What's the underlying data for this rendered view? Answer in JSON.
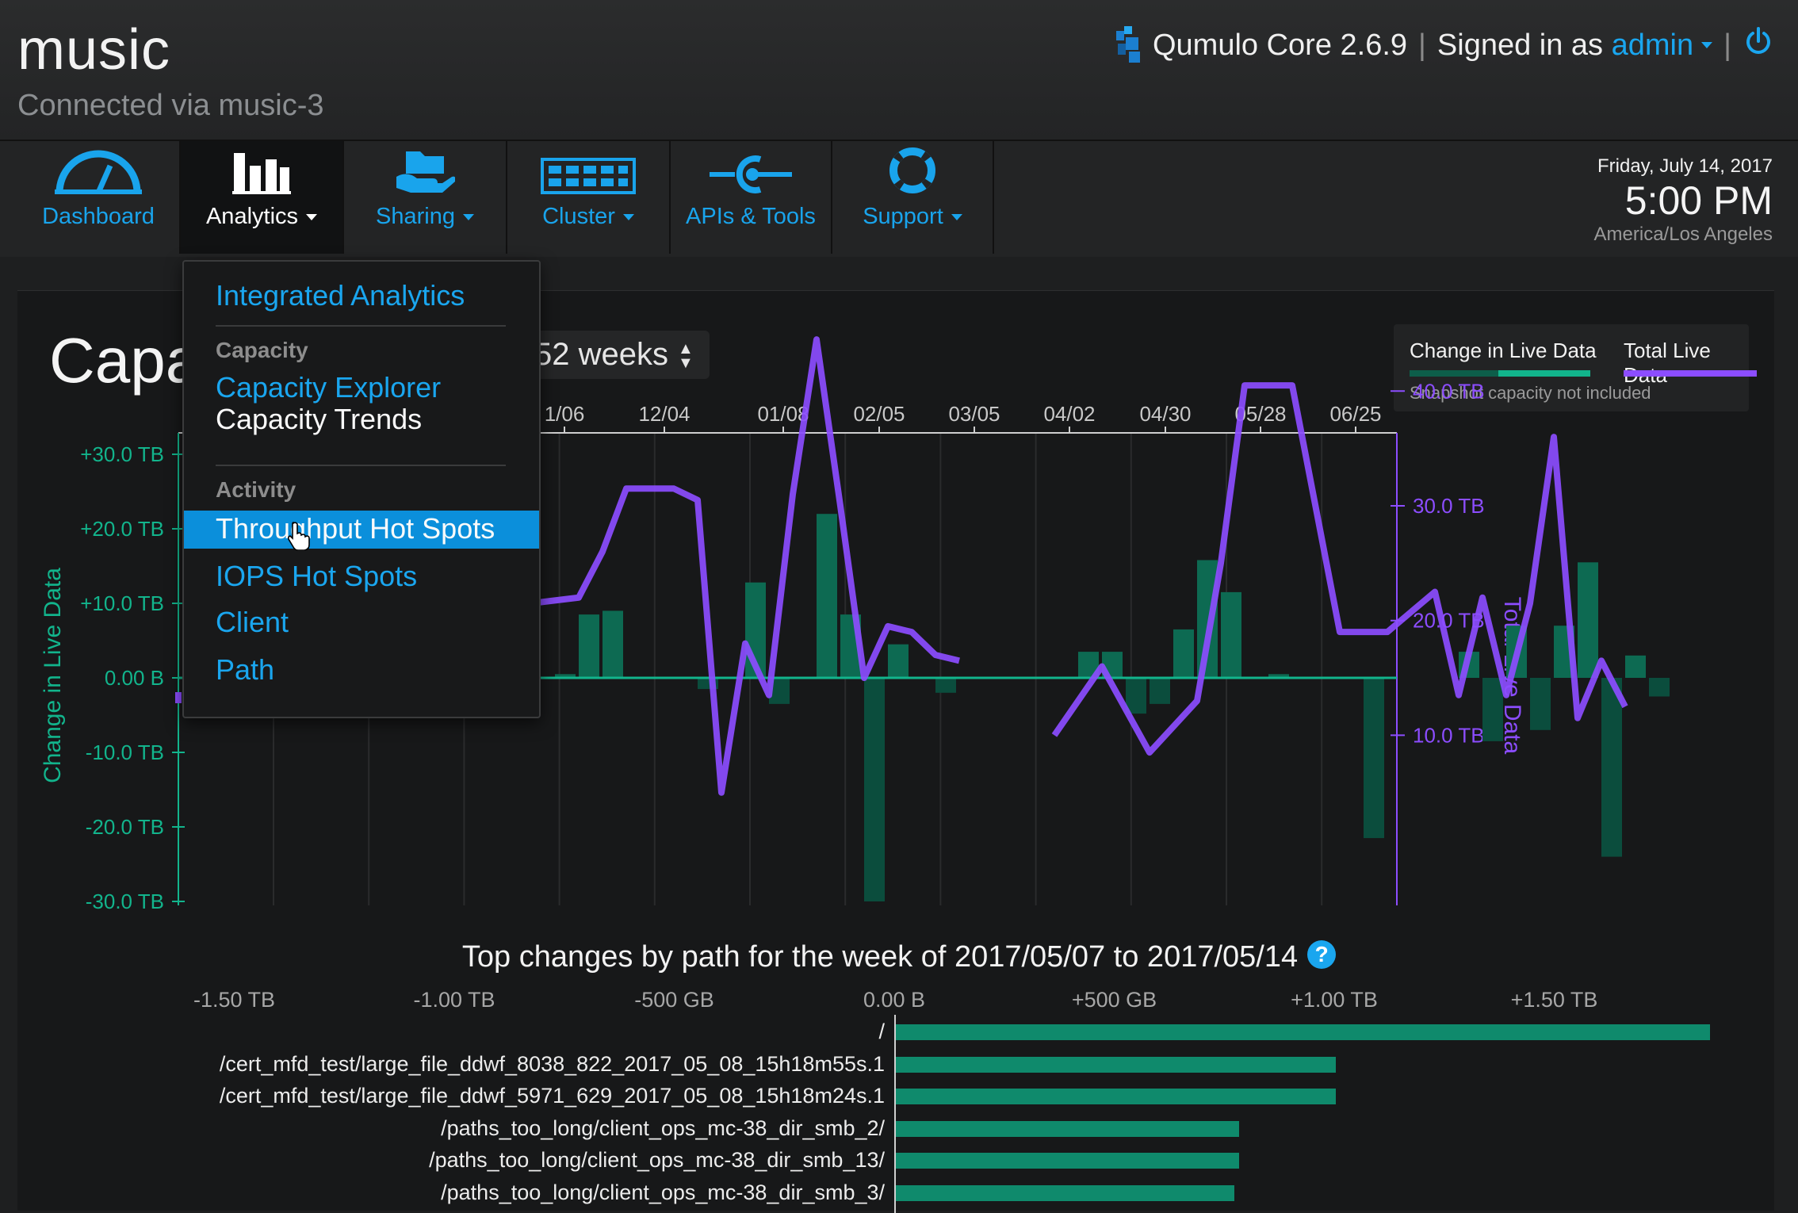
{
  "header": {
    "cluster_name": "music",
    "connected_via": "Connected via music-3",
    "product": "Qumulo Core 2.6.9",
    "signed_in_prefix": "Signed in as",
    "user": "admin"
  },
  "nav": {
    "items": [
      {
        "label": "Dashboard",
        "icon": "gauge-icon"
      },
      {
        "label": "Analytics",
        "icon": "bar-chart-icon"
      },
      {
        "label": "Sharing",
        "icon": "folder-hand-icon"
      },
      {
        "label": "Cluster",
        "icon": "server-grid-icon"
      },
      {
        "label": "APIs & Tools",
        "icon": "api-icon"
      },
      {
        "label": "Support",
        "icon": "lifebuoy-icon"
      }
    ]
  },
  "datetime": {
    "date": "Friday, July 14, 2017",
    "time": "5:00 PM",
    "timezone": "America/Los Angeles"
  },
  "page": {
    "title": "Capacity Trends",
    "range": "52 weeks"
  },
  "dropdown": {
    "integrated": "Integrated Analytics",
    "capacity_heading": "Capacity",
    "capacity_explorer": "Capacity Explorer",
    "capacity_trends": "Capacity Trends",
    "activity_heading": "Activity",
    "throughput": "Throughput Hot Spots",
    "iops": "IOPS Hot Spots",
    "client": "Client",
    "path": "Path"
  },
  "legend": {
    "change": "Change in Live Data",
    "total": "Total Live Data",
    "note": "Snapshot capacity not included",
    "colors": {
      "change_dark": "#0d5e4a",
      "change_light": "#12b48c",
      "total": "#8c4dff"
    }
  },
  "chart_data": [
    {
      "type": "bar",
      "title": "",
      "xlabel": "",
      "ylabel": "Change in Live Data",
      "y2label": "Total Live Data",
      "x_ticks": [
        "1/06",
        "12/04",
        "01/08",
        "02/05",
        "03/05",
        "04/02",
        "04/30",
        "05/28",
        "06/25"
      ],
      "y_ticks": [
        "+30.0 TB",
        "+20.0 TB",
        "+10.0 TB",
        "0.00 B",
        "-10.0 TB",
        "-20.0 TB",
        "-30.0 TB"
      ],
      "y2_ticks": [
        "40.0 TB",
        "30.0 TB",
        "20.0 TB",
        "10.0 TB"
      ],
      "ylim": [
        -30,
        30
      ],
      "y2lim": [
        5,
        45
      ],
      "series": [
        {
          "name": "Change in Live Data",
          "unit": "TB",
          "x": [
            39.5,
            40,
            40.5,
            41,
            41.5,
            42,
            42.5,
            43,
            43.5,
            44,
            44.5,
            45,
            45.5,
            46,
            46.5,
            47,
            47.5,
            48,
            48.5,
            49,
            49.5,
            50,
            50.5,
            51,
            51.5,
            52,
            52.5,
            53,
            53.5,
            54,
            54.5,
            55,
            55.5,
            56,
            56.5,
            57,
            57.5,
            58,
            58.5,
            59,
            59.5,
            60,
            60.5,
            61,
            61.5,
            62,
            62.5,
            63,
            63.5,
            64,
            64.5,
            65,
            65.5,
            66,
            66.5,
            67,
            67.5,
            68
          ],
          "values": [
            0.5,
            8.5,
            9,
            0,
            0,
            0,
            -1.5,
            0,
            12.8,
            -3.5,
            0,
            22,
            8.5,
            -30,
            4.5,
            0,
            -2,
            0,
            0,
            0,
            0,
            0,
            3.5,
            3.5,
            -4.8,
            -3.5,
            6.5,
            15.8,
            11.5,
            0,
            0.5,
            0,
            0,
            0,
            -21.5,
            0,
            0,
            0,
            3.5,
            -8.5,
            7,
            -7,
            7,
            15.5,
            -24,
            3,
            -2.5,
            0,
            0,
            0,
            0,
            0,
            0,
            0,
            0,
            0,
            0,
            0
          ]
        },
        {
          "name": "Total Live Data",
          "unit": "TB",
          "x": [
            36,
            36.5,
            37,
            38,
            39,
            40,
            40.5,
            41,
            42,
            42.5,
            43,
            43.5,
            44,
            44.5,
            45,
            45.5,
            46,
            46.5,
            47,
            47.5,
            48,
            49,
            50,
            51,
            52,
            53,
            53.5,
            54,
            55,
            56,
            56.5,
            57,
            58,
            58.5,
            59,
            59.5,
            60,
            60.5,
            61,
            61.5,
            62,
            62.5,
            63,
            63.5,
            64
          ],
          "values": [
            22.5,
            21.5,
            21,
            21,
            21.5,
            22,
            26,
            31.5,
            31.5,
            30.5,
            5,
            18,
            13.5,
            31,
            44.5,
            30,
            15,
            19.5,
            19,
            17,
            16.5,
            null,
            10,
            16,
            8.5,
            13,
            25,
            40.5,
            40.5,
            19,
            19,
            19,
            22.5,
            13.5,
            22,
            13.5,
            21.5,
            36,
            11.5,
            16.5,
            12.5,
            null,
            null,
            null,
            null
          ]
        }
      ]
    },
    {
      "type": "bar",
      "orientation": "horizontal",
      "title": "Top changes by path for the week of 2017/05/07 to 2017/05/14",
      "x_ticks": [
        "-1.50 TB",
        "-1.00 TB",
        "-500 GB",
        "0.00 B",
        "+500 GB",
        "+1.00 TB",
        "+1.50 TB"
      ],
      "xlim": [
        -1.5,
        1.5
      ],
      "categories": [
        "/",
        "/cert_mfd_test/large_file_ddwf_8038_822_2017_05_08_15h18m55s.1",
        "/cert_mfd_test/large_file_ddwf_5971_629_2017_05_08_15h18m24s.1",
        "/paths_too_long/client_ops_mc-38_dir_smb_2/",
        "/paths_too_long/client_ops_mc-38_dir_smb_13/",
        "/paths_too_long/client_ops_mc-38_dir_smb_3/"
      ],
      "values": [
        1.85,
        1.0,
        1.0,
        0.78,
        0.78,
        0.77
      ],
      "unit": "TB"
    }
  ]
}
